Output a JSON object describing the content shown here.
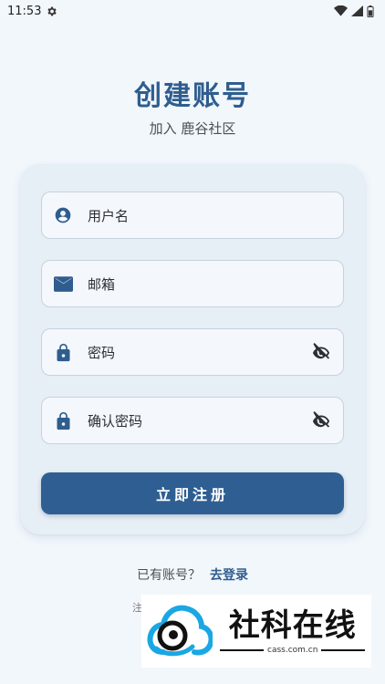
{
  "status_bar": {
    "time": "11:53",
    "icons": [
      "settings-icon",
      "wifi-icon",
      "signal-icon",
      "battery-icon"
    ]
  },
  "header": {
    "title": "创建账号",
    "subtitle": "加入 鹿谷社区"
  },
  "form": {
    "fields": [
      {
        "label": "用户名",
        "icon": "account-circle-icon"
      },
      {
        "label": "邮箱",
        "icon": "mail-icon"
      },
      {
        "label": "密码",
        "icon": "lock-icon",
        "trailing_icon": "visibility-off-icon"
      },
      {
        "label": "确认密码",
        "icon": "lock-icon",
        "trailing_icon": "visibility-off-icon"
      }
    ],
    "submit_label": "立即注册"
  },
  "footer": {
    "question": "已有账号？",
    "login_link": "去登录",
    "note_fragment": "注"
  },
  "watermark": {
    "name": "社科在线",
    "url": "cass.com.cn"
  },
  "colors": {
    "accent": "#2f5d8e",
    "button": "#2f5f92",
    "background": "#f2f7fc",
    "card": "#e6eef6",
    "field": "#f4f8fc"
  }
}
